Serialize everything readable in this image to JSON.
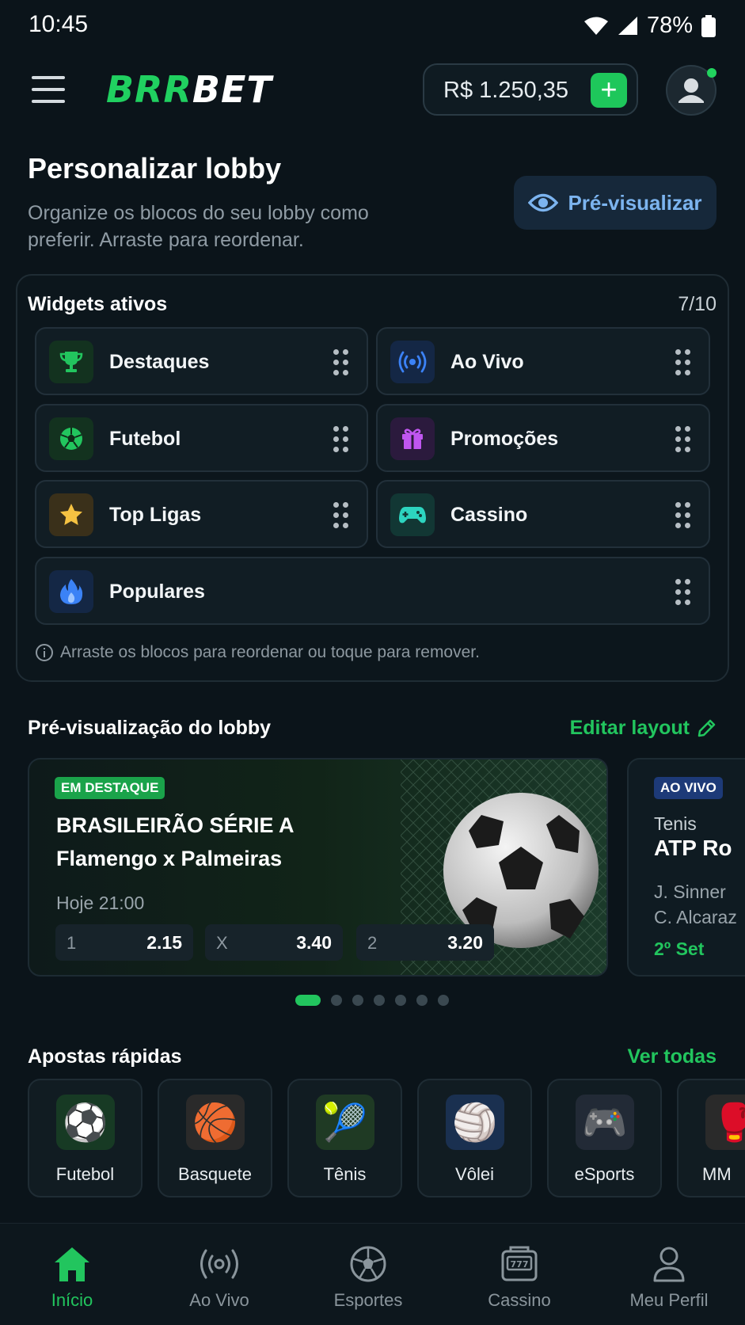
{
  "status_bar": {
    "time": "10:45",
    "battery": "78%"
  },
  "header": {
    "logo_part1": "BRR",
    "logo_part2": "BET",
    "balance": "R$ 1.250,35",
    "deposit": "+"
  },
  "page": {
    "title": "Personalizar lobby",
    "subtitle": "Organize os blocos do seu lobby como preferir. Arraste para reordenar.",
    "preview_button": "Pré-visualizar"
  },
  "widgets": {
    "title": "Widgets ativos",
    "count": "7/10",
    "items": [
      {
        "label": "Destaques",
        "icon": "trophy-icon",
        "color": "#22c55e"
      },
      {
        "label": "Ao Vivo",
        "icon": "broadcast-icon",
        "color": "#3b82f6"
      },
      {
        "label": "Futebol",
        "icon": "soccer-ball-icon",
        "color": "#22c55e"
      },
      {
        "label": "Promoções",
        "icon": "gift-icon",
        "color": "#c056f0"
      },
      {
        "label": "Top Ligas",
        "icon": "star-icon",
        "color": "#f5c242"
      },
      {
        "label": "Cassino",
        "icon": "gamepad-icon",
        "color": "#2dd4bf"
      },
      {
        "label": "Populares",
        "icon": "flame-icon",
        "color": "#3b82f6"
      }
    ],
    "hint": "Arraste os blocos para reordenar ou toque para remover."
  },
  "lobby_preview": {
    "title": "Pré-visualização do lobby",
    "edit_link": "Editar layout",
    "featured": {
      "badge": "EM DESTAQUE",
      "league": "BRASILEIRÃO SÉRIE A",
      "teams": "Flamengo x Palmeiras",
      "time": "Hoje 21:00",
      "odds": [
        {
          "key": "1",
          "value": "2.15"
        },
        {
          "key": "X",
          "value": "3.40"
        },
        {
          "key": "2",
          "value": "3.20"
        }
      ]
    },
    "live": {
      "badge": "AO VIVO",
      "sport": "Tenis",
      "event": "ATP Ro",
      "player1": "J. Sinner",
      "player2": "C. Alcaraz",
      "set": "2º Set"
    }
  },
  "quick_bets": {
    "title": "Apostas rápidas",
    "link": "Ver todas",
    "items": [
      {
        "label": "Futebol",
        "emoji": "⚽"
      },
      {
        "label": "Basquete",
        "emoji": "🏀"
      },
      {
        "label": "Tênis",
        "emoji": "🎾"
      },
      {
        "label": "Vôlei",
        "emoji": "🏐"
      },
      {
        "label": "eSports",
        "emoji": "🎮"
      },
      {
        "label": "MM",
        "emoji": "🥊"
      }
    ]
  },
  "bottom_nav": {
    "items": [
      {
        "label": "Início"
      },
      {
        "label": "Ao Vivo"
      },
      {
        "label": "Esportes"
      },
      {
        "label": "Cassino"
      },
      {
        "label": "Meu Perfil"
      }
    ]
  },
  "colors": {
    "accent": "#22c55e",
    "background": "#0b141a",
    "preview_button": "#7cb4ef"
  }
}
